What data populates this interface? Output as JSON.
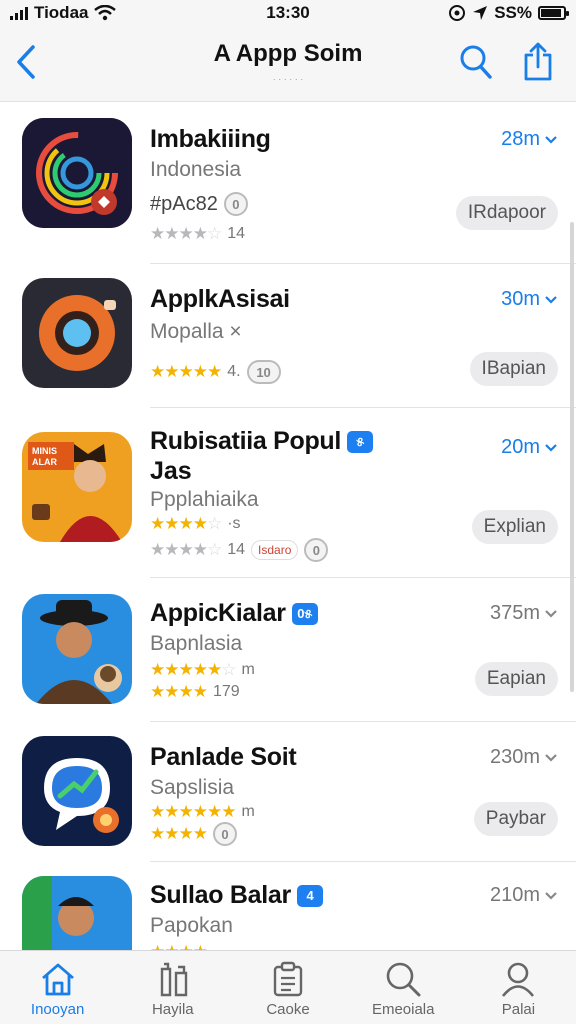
{
  "status_bar": {
    "carrier": "Tiodaa",
    "time": "13:30",
    "battery": "SS%"
  },
  "nav": {
    "title": "A Appp Soim",
    "subtitle": "· · · · · ·"
  },
  "apps": [
    {
      "name": "Imbakiiing",
      "subtitle": "Indonesia",
      "meta_text": "#pAc82",
      "badge": "0",
      "rating_count": "14",
      "size": "28m",
      "button": "IRdapoor",
      "stars": 3.5
    },
    {
      "name": "ApplkAsisai",
      "subtitle": "Mopalla ×",
      "rating_count": "4.",
      "badge": "10",
      "size": "30m",
      "button": "IBapian",
      "stars": 5
    },
    {
      "name": "Rubisatiia Popul",
      "name_line2": "Jas",
      "verified": "୫",
      "subtitle": "Ppplahiaika",
      "rating_count": "14",
      "rating_small": "·s",
      "pill": "Isdaro",
      "badge": "0",
      "size": "20m",
      "button": "Explian",
      "stars": 4
    },
    {
      "name": "AppicKialar",
      "verified": "0୫",
      "subtitle": "Bapnlasia",
      "rating_count": "179",
      "rating_small": "m",
      "size": "375m",
      "button": "Eapian",
      "stars": 4
    },
    {
      "name": "Panlade Soit",
      "subtitle": "Sapslisia",
      "rating_small": "m",
      "badge": "0",
      "size": "230m",
      "button": "Paybar",
      "stars": 4
    },
    {
      "name": "Sullao Balar",
      "verified": "4",
      "subtitle": "Papokan",
      "size": "210m",
      "stars": 4
    }
  ],
  "tabs": [
    {
      "label": "Inooyan",
      "active": true
    },
    {
      "label": "Hayila",
      "active": false
    },
    {
      "label": "Caoke",
      "active": false
    },
    {
      "label": "Emeoiala",
      "active": false
    },
    {
      "label": "Palai",
      "active": false
    }
  ],
  "colors": {
    "accent": "#1a7ee8",
    "star": "#f5b301"
  }
}
